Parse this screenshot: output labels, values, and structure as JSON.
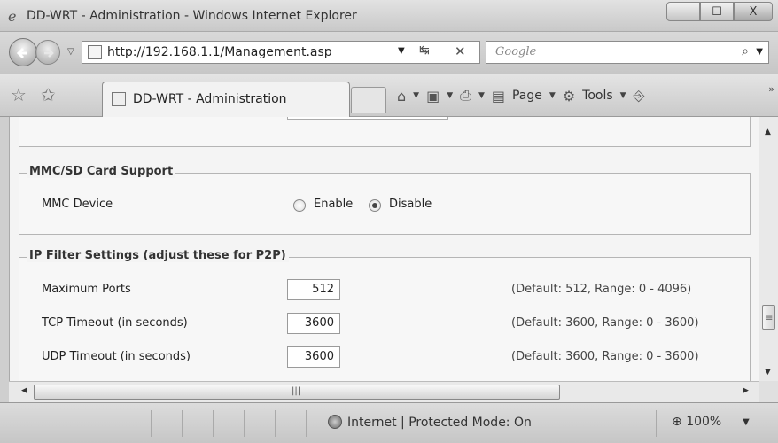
{
  "window": {
    "title": "DD-WRT - Administration - Windows Internet Explorer",
    "buttons": {
      "minimize": "—",
      "maximize": "☐",
      "close": "X"
    }
  },
  "address_bar": {
    "url": "http://192.168.1.1/Management.asp",
    "search_placeholder": "Google"
  },
  "tab": {
    "label": "DD-WRT - Administration"
  },
  "commands": {
    "page": "Page",
    "tools": "Tools"
  },
  "sections": {
    "mmc": {
      "legend": "MMC/SD Card Support",
      "row_label": "MMC Device",
      "options": [
        "Enable",
        "Disable"
      ],
      "selected": "Disable"
    },
    "ip_filter": {
      "legend": "IP Filter Settings (adjust these for P2P)",
      "rows": [
        {
          "label": "Maximum Ports",
          "value": "512",
          "hint": "(Default: 512, Range: 0 - 4096)"
        },
        {
          "label": "TCP Timeout (in seconds)",
          "value": "3600",
          "hint": "(Default: 3600, Range: 0 - 3600)"
        },
        {
          "label": "UDP Timeout (in seconds)",
          "value": "3600",
          "hint": "(Default: 3600, Range: 0 - 3600)"
        }
      ]
    }
  },
  "status_bar": {
    "zone": "Internet | Protected Mode: On",
    "zoom": "100%"
  }
}
